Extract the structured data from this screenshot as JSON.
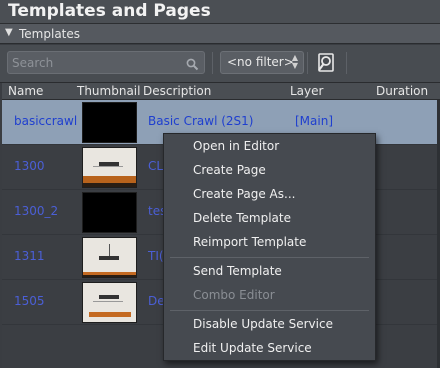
{
  "panel": {
    "title": "Templates and Pages"
  },
  "section": {
    "label": "Templates"
  },
  "toolbar": {
    "search_placeholder": "Search",
    "filter_value": "<no filter>"
  },
  "table": {
    "columns": [
      "Name",
      "Thumbnail",
      "Description",
      "Layer",
      "Duration"
    ],
    "rows": [
      {
        "name": "basiccrawl",
        "description": "Basic Crawl (2S1)",
        "layer": "[Main]",
        "thumbnail": "black",
        "selected": true
      },
      {
        "name": "1300",
        "description": "CL",
        "layer": "",
        "thumbnail": "light-orange"
      },
      {
        "name": "1300_2",
        "description": "tes",
        "layer": "",
        "thumbnail": "black"
      },
      {
        "name": "1311",
        "description": "TI(",
        "layer": "",
        "thumbnail": "light-pole"
      },
      {
        "name": "1505",
        "description": "De",
        "layer": "",
        "thumbnail": "light-band"
      }
    ]
  },
  "context_menu": {
    "items": [
      {
        "label": "Open in Editor",
        "enabled": true
      },
      {
        "label": "Create Page",
        "enabled": true
      },
      {
        "label": "Create Page As...",
        "enabled": true
      },
      {
        "label": "Delete Template",
        "enabled": true
      },
      {
        "label": "Reimport Template",
        "enabled": true
      },
      {
        "label": "Send Template",
        "enabled": true
      },
      {
        "label": "Combo Editor",
        "enabled": false
      },
      {
        "label": "Disable Update Service",
        "enabled": true
      },
      {
        "label": "Edit Update Service",
        "enabled": true
      }
    ]
  },
  "colors": {
    "selected_row": "#8ea0b6",
    "link_text": "#4b5fd6",
    "panel_bg": "#3a3d42",
    "menu_bg": "#464a50"
  },
  "icons": {
    "search": "magnifier-icon",
    "advanced_search": "search-document-icon",
    "collapse": "triangle-down-icon",
    "filter_arrows": "updown-arrows-icon"
  }
}
